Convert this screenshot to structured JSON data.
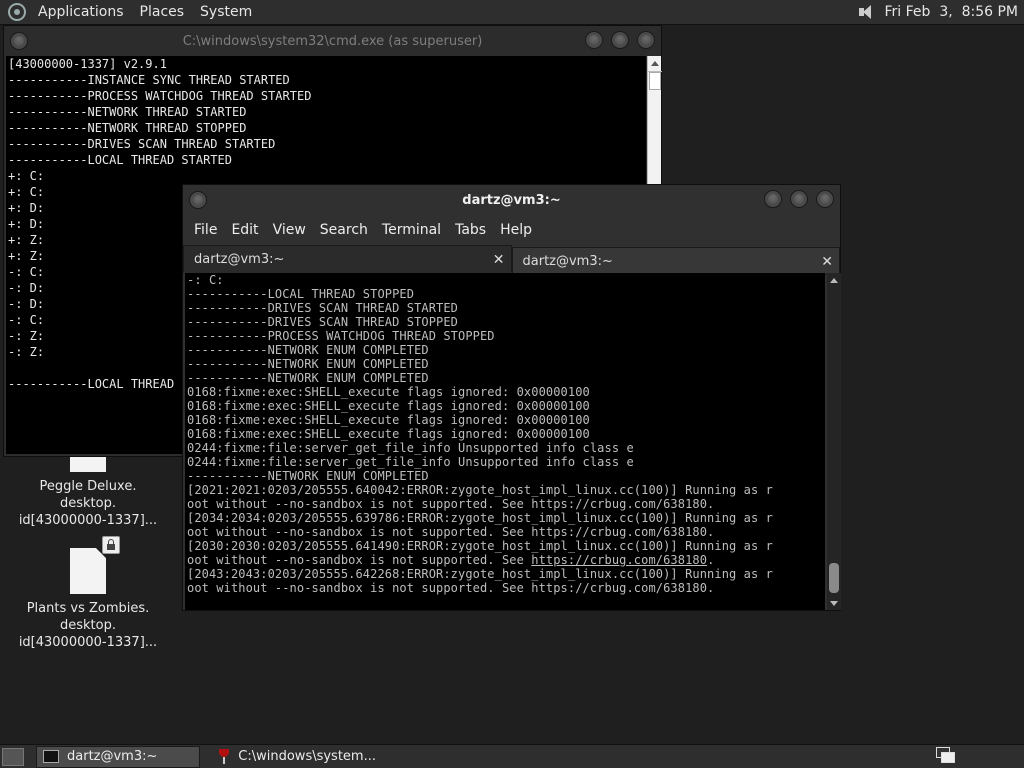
{
  "top_panel": {
    "menus": [
      "Applications",
      "Places",
      "System"
    ],
    "clock": "Fri Feb  3,  8:56 PM",
    "icons": {
      "menu": "gnome-foot-icon",
      "volume": "volume-icon"
    }
  },
  "cmd_window": {
    "title": "C:\\windows\\system32\\cmd.exe (as superuser)",
    "lines": [
      "[43000000-1337] v2.9.1",
      "-----------INSTANCE SYNC THREAD STARTED",
      "-----------PROCESS WATCHDOG THREAD STARTED",
      "-----------NETWORK THREAD STARTED",
      "-----------NETWORK THREAD STOPPED",
      "-----------DRIVES SCAN THREAD STARTED",
      "-----------LOCAL THREAD STARTED",
      "+: C:",
      "+: C:",
      "+: D:",
      "+: D:",
      "+: Z:",
      "+: Z:",
      "-: C:",
      "-: D:",
      "-: D:",
      "-: C:",
      "-: Z:",
      "-: Z:",
      "",
      "-----------LOCAL THREAD STOPPED"
    ]
  },
  "terminal_window": {
    "title": "dartz@vm3:~",
    "menus": [
      "File",
      "Edit",
      "View",
      "Search",
      "Terminal",
      "Tabs",
      "Help"
    ],
    "tabs": [
      {
        "label": "dartz@vm3:~",
        "active": true
      },
      {
        "label": "dartz@vm3:~",
        "active": false
      }
    ],
    "lines": [
      "-: C:",
      "-----------LOCAL THREAD STOPPED",
      "-----------DRIVES SCAN THREAD STARTED",
      "-----------DRIVES SCAN THREAD STOPPED",
      "-----------PROCESS WATCHDOG THREAD STOPPED",
      "-----------NETWORK ENUM COMPLETED",
      "-----------NETWORK ENUM COMPLETED",
      "-----------NETWORK ENUM COMPLETED",
      "0168:fixme:exec:SHELL_execute flags ignored: 0x00000100",
      "0168:fixme:exec:SHELL_execute flags ignored: 0x00000100",
      "0168:fixme:exec:SHELL_execute flags ignored: 0x00000100",
      "0168:fixme:exec:SHELL_execute flags ignored: 0x00000100",
      "0244:fixme:file:server_get_file_info Unsupported info class e",
      "0244:fixme:file:server_get_file_info Unsupported info class e",
      "-----------NETWORK ENUM COMPLETED",
      "[2021:2021:0203/205555.640042:ERROR:zygote_host_impl_linux.cc(100)] Running as r",
      "oot without --no-sandbox is not supported. See https://crbug.com/638180.",
      "[2034:2034:0203/205555.639786:ERROR:zygote_host_impl_linux.cc(100)] Running as r",
      "oot without --no-sandbox is not supported. See https://crbug.com/638180.",
      "[2030:2030:0203/205555.641490:ERROR:zygote_host_impl_linux.cc(100)] Running as r",
      "oot without --no-sandbox is not supported. See ",
      "[2043:2043:0203/205555.642268:ERROR:zygote_host_impl_linux.cc(100)] Running as r",
      "oot without --no-sandbox is not supported. See https://crbug.com/638180."
    ],
    "link_line_link": "https://crbug.com/638180",
    "link_line_tail": "."
  },
  "desktop_icons": [
    {
      "label_lines": [
        "Peggle Deluxe.",
        "desktop.",
        "id[43000000-1337]..."
      ],
      "icon": "file-icon"
    },
    {
      "label_lines": [
        "Plants vs Zombies.",
        "desktop.",
        "id[43000000-1337]..."
      ],
      "icon": "file-icon",
      "badge": "lock-icon"
    }
  ],
  "taskbar": {
    "tasks": [
      {
        "label": "dartz@vm3:~",
        "icon": "terminal-icon",
        "active": true
      },
      {
        "label": "C:\\windows\\system...",
        "icon": "wine-icon",
        "active": false
      }
    ],
    "icons": {
      "show_desktop": "show-desktop-icon",
      "workspace": "workspace-switcher-icon"
    }
  }
}
